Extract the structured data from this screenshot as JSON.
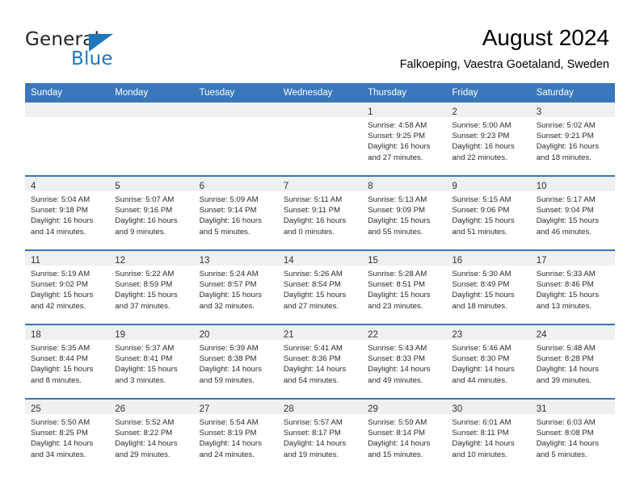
{
  "brand": {
    "name_part1": "General",
    "name_part2": "Blue",
    "accent_color": "#1e76bd"
  },
  "header": {
    "title": "August 2024",
    "location": "Falkoeping, Vaestra Goetaland, Sweden"
  },
  "calendar": {
    "header_bg": "#3a77ba",
    "daynum_bg": "#f0f0f0",
    "weekdays": [
      "Sunday",
      "Monday",
      "Tuesday",
      "Wednesday",
      "Thursday",
      "Friday",
      "Saturday"
    ],
    "weeks": [
      [
        {
          "day": "",
          "empty": true,
          "lines": [
            "",
            "",
            "",
            ""
          ]
        },
        {
          "day": "",
          "empty": true,
          "lines": [
            "",
            "",
            "",
            ""
          ]
        },
        {
          "day": "",
          "empty": true,
          "lines": [
            "",
            "",
            "",
            ""
          ]
        },
        {
          "day": "",
          "empty": true,
          "lines": [
            "",
            "",
            "",
            ""
          ]
        },
        {
          "day": "1",
          "empty": false,
          "lines": [
            "Sunrise: 4:58 AM",
            "Sunset: 9:25 PM",
            "Daylight: 16 hours",
            "and 27 minutes."
          ]
        },
        {
          "day": "2",
          "empty": false,
          "lines": [
            "Sunrise: 5:00 AM",
            "Sunset: 9:23 PM",
            "Daylight: 16 hours",
            "and 22 minutes."
          ]
        },
        {
          "day": "3",
          "empty": false,
          "lines": [
            "Sunrise: 5:02 AM",
            "Sunset: 9:21 PM",
            "Daylight: 16 hours",
            "and 18 minutes."
          ]
        }
      ],
      [
        {
          "day": "4",
          "empty": false,
          "lines": [
            "Sunrise: 5:04 AM",
            "Sunset: 9:18 PM",
            "Daylight: 16 hours",
            "and 14 minutes."
          ]
        },
        {
          "day": "5",
          "empty": false,
          "lines": [
            "Sunrise: 5:07 AM",
            "Sunset: 9:16 PM",
            "Daylight: 16 hours",
            "and 9 minutes."
          ]
        },
        {
          "day": "6",
          "empty": false,
          "lines": [
            "Sunrise: 5:09 AM",
            "Sunset: 9:14 PM",
            "Daylight: 16 hours",
            "and 5 minutes."
          ]
        },
        {
          "day": "7",
          "empty": false,
          "lines": [
            "Sunrise: 5:11 AM",
            "Sunset: 9:11 PM",
            "Daylight: 16 hours",
            "and 0 minutes."
          ]
        },
        {
          "day": "8",
          "empty": false,
          "lines": [
            "Sunrise: 5:13 AM",
            "Sunset: 9:09 PM",
            "Daylight: 15 hours",
            "and 55 minutes."
          ]
        },
        {
          "day": "9",
          "empty": false,
          "lines": [
            "Sunrise: 5:15 AM",
            "Sunset: 9:06 PM",
            "Daylight: 15 hours",
            "and 51 minutes."
          ]
        },
        {
          "day": "10",
          "empty": false,
          "lines": [
            "Sunrise: 5:17 AM",
            "Sunset: 9:04 PM",
            "Daylight: 15 hours",
            "and 46 minutes."
          ]
        }
      ],
      [
        {
          "day": "11",
          "empty": false,
          "lines": [
            "Sunrise: 5:19 AM",
            "Sunset: 9:02 PM",
            "Daylight: 15 hours",
            "and 42 minutes."
          ]
        },
        {
          "day": "12",
          "empty": false,
          "lines": [
            "Sunrise: 5:22 AM",
            "Sunset: 8:59 PM",
            "Daylight: 15 hours",
            "and 37 minutes."
          ]
        },
        {
          "day": "13",
          "empty": false,
          "lines": [
            "Sunrise: 5:24 AM",
            "Sunset: 8:57 PM",
            "Daylight: 15 hours",
            "and 32 minutes."
          ]
        },
        {
          "day": "14",
          "empty": false,
          "lines": [
            "Sunrise: 5:26 AM",
            "Sunset: 8:54 PM",
            "Daylight: 15 hours",
            "and 27 minutes."
          ]
        },
        {
          "day": "15",
          "empty": false,
          "lines": [
            "Sunrise: 5:28 AM",
            "Sunset: 8:51 PM",
            "Daylight: 15 hours",
            "and 23 minutes."
          ]
        },
        {
          "day": "16",
          "empty": false,
          "lines": [
            "Sunrise: 5:30 AM",
            "Sunset: 8:49 PM",
            "Daylight: 15 hours",
            "and 18 minutes."
          ]
        },
        {
          "day": "17",
          "empty": false,
          "lines": [
            "Sunrise: 5:33 AM",
            "Sunset: 8:46 PM",
            "Daylight: 15 hours",
            "and 13 minutes."
          ]
        }
      ],
      [
        {
          "day": "18",
          "empty": false,
          "lines": [
            "Sunrise: 5:35 AM",
            "Sunset: 8:44 PM",
            "Daylight: 15 hours",
            "and 8 minutes."
          ]
        },
        {
          "day": "19",
          "empty": false,
          "lines": [
            "Sunrise: 5:37 AM",
            "Sunset: 8:41 PM",
            "Daylight: 15 hours",
            "and 3 minutes."
          ]
        },
        {
          "day": "20",
          "empty": false,
          "lines": [
            "Sunrise: 5:39 AM",
            "Sunset: 8:38 PM",
            "Daylight: 14 hours",
            "and 59 minutes."
          ]
        },
        {
          "day": "21",
          "empty": false,
          "lines": [
            "Sunrise: 5:41 AM",
            "Sunset: 8:36 PM",
            "Daylight: 14 hours",
            "and 54 minutes."
          ]
        },
        {
          "day": "22",
          "empty": false,
          "lines": [
            "Sunrise: 5:43 AM",
            "Sunset: 8:33 PM",
            "Daylight: 14 hours",
            "and 49 minutes."
          ]
        },
        {
          "day": "23",
          "empty": false,
          "lines": [
            "Sunrise: 5:46 AM",
            "Sunset: 8:30 PM",
            "Daylight: 14 hours",
            "and 44 minutes."
          ]
        },
        {
          "day": "24",
          "empty": false,
          "lines": [
            "Sunrise: 5:48 AM",
            "Sunset: 8:28 PM",
            "Daylight: 14 hours",
            "and 39 minutes."
          ]
        }
      ],
      [
        {
          "day": "25",
          "empty": false,
          "lines": [
            "Sunrise: 5:50 AM",
            "Sunset: 8:25 PM",
            "Daylight: 14 hours",
            "and 34 minutes."
          ]
        },
        {
          "day": "26",
          "empty": false,
          "lines": [
            "Sunrise: 5:52 AM",
            "Sunset: 8:22 PM",
            "Daylight: 14 hours",
            "and 29 minutes."
          ]
        },
        {
          "day": "27",
          "empty": false,
          "lines": [
            "Sunrise: 5:54 AM",
            "Sunset: 8:19 PM",
            "Daylight: 14 hours",
            "and 24 minutes."
          ]
        },
        {
          "day": "28",
          "empty": false,
          "lines": [
            "Sunrise: 5:57 AM",
            "Sunset: 8:17 PM",
            "Daylight: 14 hours",
            "and 19 minutes."
          ]
        },
        {
          "day": "29",
          "empty": false,
          "lines": [
            "Sunrise: 5:59 AM",
            "Sunset: 8:14 PM",
            "Daylight: 14 hours",
            "and 15 minutes."
          ]
        },
        {
          "day": "30",
          "empty": false,
          "lines": [
            "Sunrise: 6:01 AM",
            "Sunset: 8:11 PM",
            "Daylight: 14 hours",
            "and 10 minutes."
          ]
        },
        {
          "day": "31",
          "empty": false,
          "lines": [
            "Sunrise: 6:03 AM",
            "Sunset: 8:08 PM",
            "Daylight: 14 hours",
            "and 5 minutes."
          ]
        }
      ]
    ]
  }
}
